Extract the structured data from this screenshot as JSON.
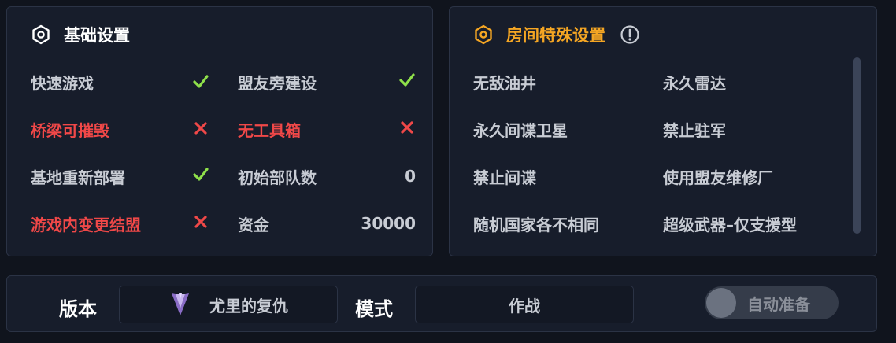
{
  "basic": {
    "title": "基础设置",
    "icon": "gear-icon",
    "left_col": [
      {
        "label": "快速游戏",
        "state": "on",
        "color": "#c8ccd4"
      },
      {
        "label": "桥梁可摧毁",
        "state": "off",
        "color": "#f04848"
      },
      {
        "label": "基地重新部署",
        "state": "on",
        "color": "#c8ccd4"
      },
      {
        "label": "游戏内变更结盟",
        "state": "off",
        "color": "#f04848"
      }
    ],
    "right_col": [
      {
        "label": "盟友旁建设",
        "state": "on",
        "color": "#c8ccd4"
      },
      {
        "label": "无工具箱",
        "state": "off",
        "color": "#f04848"
      },
      {
        "label": "初始部队数",
        "value": "0"
      },
      {
        "label": "资金",
        "value": "30000"
      }
    ]
  },
  "room": {
    "title": "房间特殊设置",
    "icon": "gear-icon",
    "info_icon": "info-icon",
    "left_col": [
      "无敌油井",
      "永久间谍卫星",
      "禁止间谍",
      "随机国家各不相同"
    ],
    "right_col": [
      "永久雷达",
      "禁止驻军",
      "使用盟友维修厂",
      "超级武器–仅支援型"
    ]
  },
  "bottom": {
    "version_label": "版本",
    "version_value": "尤里的复仇",
    "mode_label": "模式",
    "mode_value": "作战",
    "auto_ready_label": "自动准备",
    "auto_ready_on": false
  },
  "colors": {
    "check": "#8fe04a",
    "cross": "#f04848",
    "accent": "#f5a623"
  }
}
